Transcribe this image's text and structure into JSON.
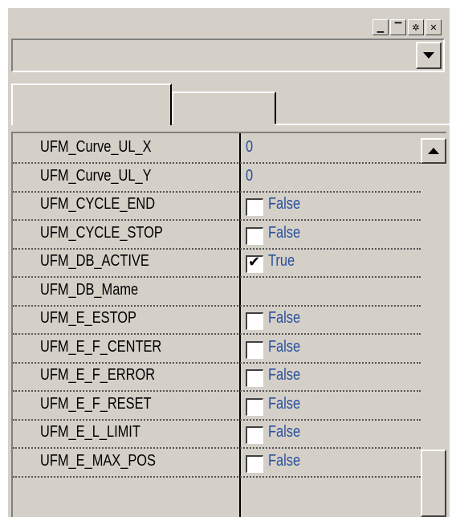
{
  "window": {
    "buttons": [
      {
        "name": "minimize-button",
        "glyph": "▁"
      },
      {
        "name": "restore-button",
        "glyph": "▔"
      },
      {
        "name": "pin-button",
        "glyph": "✲"
      },
      {
        "name": "close-button",
        "glyph": "✕"
      }
    ]
  },
  "combo": {
    "value": ""
  },
  "tabs": [
    {
      "label": ""
    },
    {
      "label": ""
    }
  ],
  "properties": [
    {
      "name": "UFM_Curve_UL_X",
      "type": "text",
      "value": "0"
    },
    {
      "name": "UFM_Curve_UL_Y",
      "type": "text",
      "value": "0"
    },
    {
      "name": "UFM_CYCLE_END",
      "type": "bool",
      "value": "False",
      "checked": false
    },
    {
      "name": "UFM_CYCLE_STOP",
      "type": "bool",
      "value": "False",
      "checked": false
    },
    {
      "name": "UFM_DB_ACTIVE",
      "type": "bool",
      "value": "True",
      "checked": true
    },
    {
      "name": "UFM_DB_Mame",
      "type": "text",
      "value": ""
    },
    {
      "name": "UFM_E_ESTOP",
      "type": "bool",
      "value": "False",
      "checked": false
    },
    {
      "name": "UFM_E_F_CENTER",
      "type": "bool",
      "value": "False",
      "checked": false
    },
    {
      "name": "UFM_E_F_ERROR",
      "type": "bool",
      "value": "False",
      "checked": false
    },
    {
      "name": "UFM_E_F_RESET",
      "type": "bool",
      "value": "False",
      "checked": false
    },
    {
      "name": "UFM_E_L_LIMIT",
      "type": "bool",
      "value": "False",
      "checked": false
    },
    {
      "name": "UFM_E_MAX_POS",
      "type": "bool",
      "value": "False",
      "checked": false
    }
  ],
  "colors": {
    "value_text": "#2b4f9c",
    "panel": "#d4d0c8"
  }
}
